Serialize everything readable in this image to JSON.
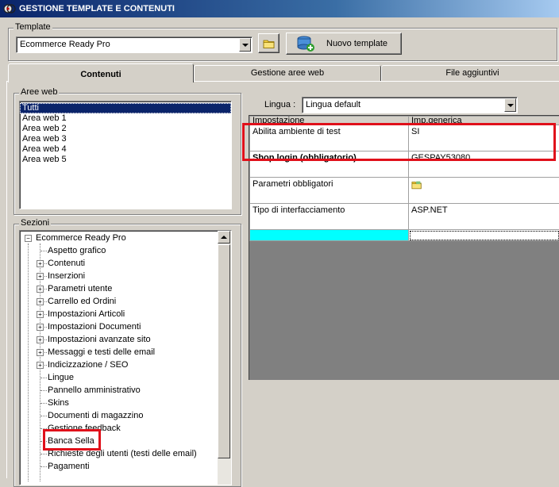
{
  "window": {
    "title": "GESTIONE TEMPLATE E CONTENUTI"
  },
  "template": {
    "label": "Template",
    "selected": "Ecommerce Ready Pro",
    "new_button": "Nuovo template"
  },
  "tabs": [
    "Contenuti",
    "Gestione aree web",
    "File aggiuntivi"
  ],
  "aree_web": {
    "label": "Aree web",
    "items": [
      "Tutti",
      "Area web 1",
      "Area web 2",
      "Area web 3",
      "Area web 4",
      "Area web 5"
    ],
    "selected_index": 0
  },
  "sezioni": {
    "label": "Sezioni",
    "root": "Ecommerce Ready Pro",
    "children": [
      {
        "label": "Aspetto grafico",
        "expandable": false
      },
      {
        "label": "Contenuti",
        "expandable": true
      },
      {
        "label": "Inserzioni",
        "expandable": true
      },
      {
        "label": "Parametri utente",
        "expandable": true
      },
      {
        "label": "Carrello ed Ordini",
        "expandable": true
      },
      {
        "label": "Impostazioni Articoli",
        "expandable": true
      },
      {
        "label": "Impostazioni Documenti",
        "expandable": true
      },
      {
        "label": "Impostazioni avanzate sito",
        "expandable": true
      },
      {
        "label": "Messaggi e testi delle email",
        "expandable": true
      },
      {
        "label": "Indicizzazione / SEO",
        "expandable": true
      },
      {
        "label": "Lingue",
        "expandable": false
      },
      {
        "label": "Pannello amministrativo",
        "expandable": false
      },
      {
        "label": "Skins",
        "expandable": false
      },
      {
        "label": "Documenti di magazzino",
        "expandable": false
      },
      {
        "label": "Gestione feedback",
        "expandable": false
      },
      {
        "label": "Banca Sella",
        "expandable": false
      },
      {
        "label": "Richieste degli utenti (testi delle email)",
        "expandable": false
      },
      {
        "label": "Pagamenti",
        "expandable": false
      }
    ]
  },
  "lingua": {
    "label": "Lingua :",
    "selected": "Lingua default"
  },
  "grid": {
    "headers": [
      "Impostazione",
      "Imp.generica"
    ],
    "rows": [
      {
        "setting": "Abilita ambiente di test",
        "value": "SI",
        "bold": false
      },
      {
        "setting": "Shop login (obbligatorio)",
        "value": "GESPAY53080",
        "bold": true
      },
      {
        "setting": "Parametri obbligatori",
        "value": "",
        "bold": false,
        "icon": "folder-icon"
      },
      {
        "setting": "Tipo di interfacciamento",
        "value": "ASP.NET",
        "bold": false
      }
    ]
  },
  "colors": {
    "highlight": "#e0101a",
    "new_row": "#00ffff",
    "selection": "#0a246a"
  }
}
